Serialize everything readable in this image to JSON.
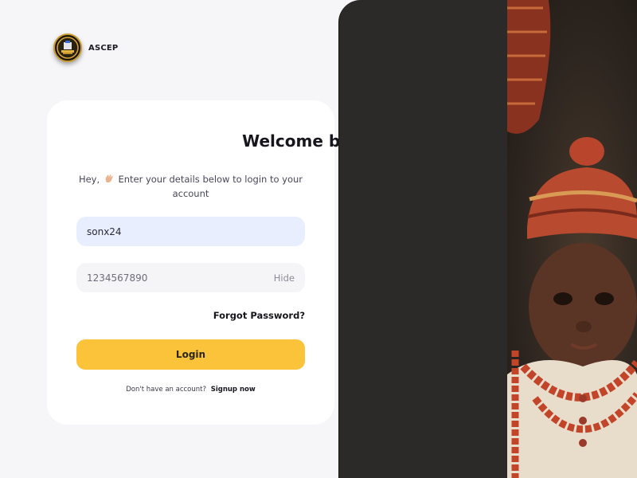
{
  "brand": {
    "name": "ASCEP"
  },
  "login_card": {
    "title": "Welcome back",
    "subtitle_before": "Hey,",
    "subtitle_after": "Enter your details below to login to your account",
    "username": {
      "value": "sonx24"
    },
    "password": {
      "value": "1234567890",
      "toggle_label": "Hide"
    },
    "forgot_label": "Forgot Password?",
    "login_label": "Login",
    "signup_prompt": "Don't have an account?",
    "signup_label": "Signup now"
  },
  "colors": {
    "accent_yellow": "#fbc33a",
    "username_field_bg": "#e8eefe",
    "password_field_bg": "#f5f4f7",
    "page_bg": "#f6f5f8",
    "panel_dark": "#2c2a28"
  },
  "icons": {
    "logo": "ascep-crest-logo",
    "title_emoji": "smiling-face-icon",
    "subtitle_emoji": "waving-hand-icon"
  }
}
